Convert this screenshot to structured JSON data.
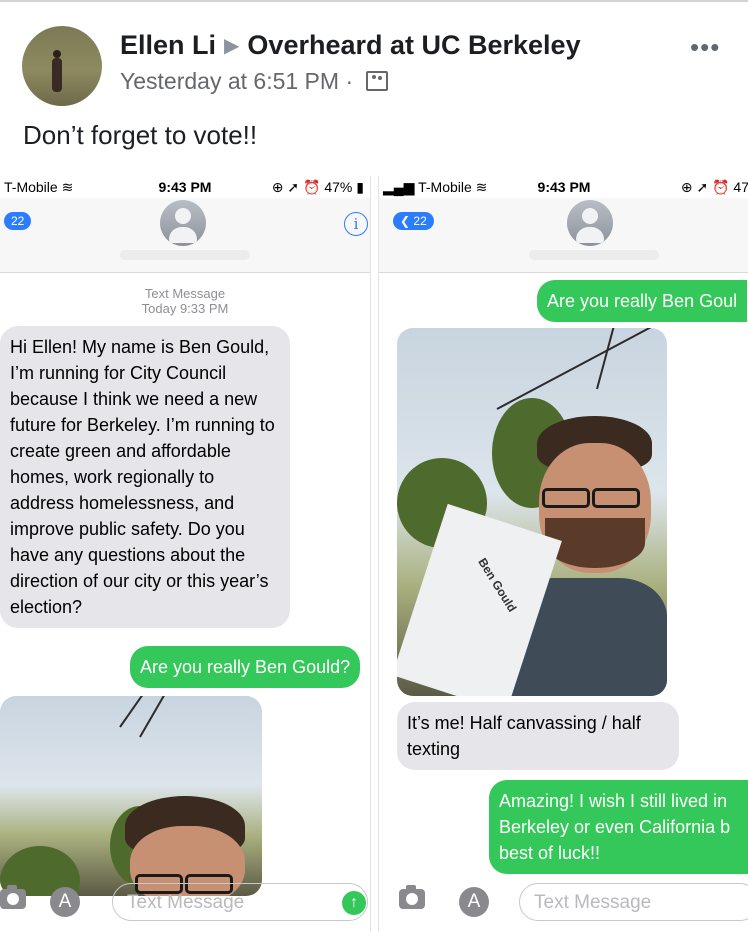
{
  "post": {
    "author": "Ellen Li",
    "group": "Overheard at UC Berkeley",
    "timestamp": "Yesterday at 6:51 PM",
    "separator": "·",
    "text": "Don’t forget to vote!!",
    "more": "•••"
  },
  "left_shot": {
    "carrier": "T-Mobile",
    "time": "9:43 PM",
    "battery": "47%",
    "badge_count": "22",
    "info_label": "i",
    "timestamp_label": "Text Message",
    "timestamp_value": "Today 9:33 PM",
    "incoming_message": "Hi Ellen! My name is Ben Gould, I’m running for City Council because I think we need a new future for Berkeley. I’m running to create green and affordable homes, work regionally to address homelessness, and improve public safety. Do you have any questions about the direction of our city or this year’s election?",
    "outgoing_message": "Are you really Ben Gould?",
    "input_placeholder": "Text Message"
  },
  "right_shot": {
    "carrier": "T-Mobile",
    "time": "9:43 PM",
    "battery": "47",
    "badge_count": "22",
    "outgoing_message_1": "Are you really Ben Goul",
    "incoming_message": "It’s me! Half canvassing / half texting",
    "outgoing_message_2": "Amazing! I wish I still lived in Berkeley or even California b best of luck!!",
    "flyer_text": "Ben Gould",
    "input_placeholder": "Text Message"
  }
}
